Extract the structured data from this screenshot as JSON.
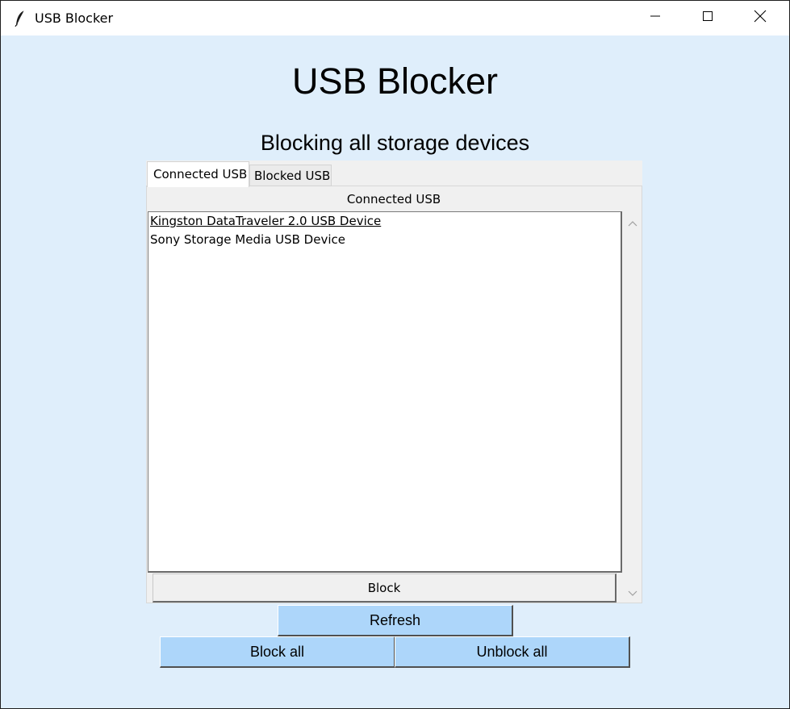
{
  "window": {
    "title": "USB Blocker",
    "controls": [
      "minimize-icon",
      "maximize-icon",
      "close-icon"
    ]
  },
  "app": {
    "heading": "USB Blocker",
    "status": "Blocking all storage devices"
  },
  "tabs": [
    {
      "label": "Connected USB",
      "active": true
    },
    {
      "label": "Blocked USB",
      "active": false
    }
  ],
  "panel": {
    "label": "Connected USB",
    "devices": [
      {
        "name": "Kingston DataTraveler 2.0 USB Device",
        "selected": true
      },
      {
        "name": "Sony Storage Media USB Device",
        "selected": false
      }
    ],
    "action_button": "Block"
  },
  "buttons": {
    "refresh": "Refresh",
    "block_all": "Block all",
    "unblock_all": "Unblock all"
  },
  "colors": {
    "background": "#dfeefb",
    "button_blue": "#add6fa"
  }
}
